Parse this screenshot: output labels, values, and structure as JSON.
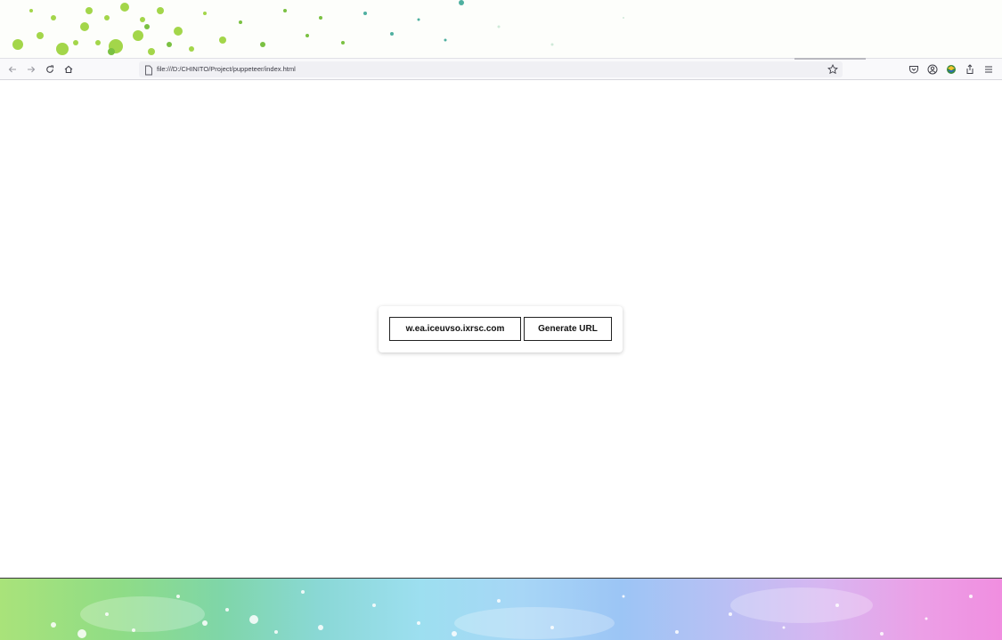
{
  "browser": {
    "url": "file:///D:/CHINITO/Project/puppeteer/index.html",
    "icons": {
      "back": "back-arrow-icon",
      "forward": "forward-arrow-icon",
      "reload": "reload-icon",
      "home": "home-icon",
      "page": "page-icon",
      "bookmark": "bookmark-star-icon",
      "pocket": "pocket-icon",
      "account": "account-icon",
      "extension": "extension-icon",
      "share": "share-icon",
      "menu": "hamburger-menu-icon"
    }
  },
  "main": {
    "url_input_value": "w.ea.iceuvso.ixrsc.com",
    "generate_button_label": "Generate URL"
  },
  "colors": {
    "toolbar_bg": "#f9f9fb",
    "urlbar_bg": "#f0f0f4",
    "card_border": "#222222",
    "wallpaper_green": "#8fdc86",
    "wallpaper_blue": "#9ddff0",
    "wallpaper_pink": "#f08ee0"
  }
}
